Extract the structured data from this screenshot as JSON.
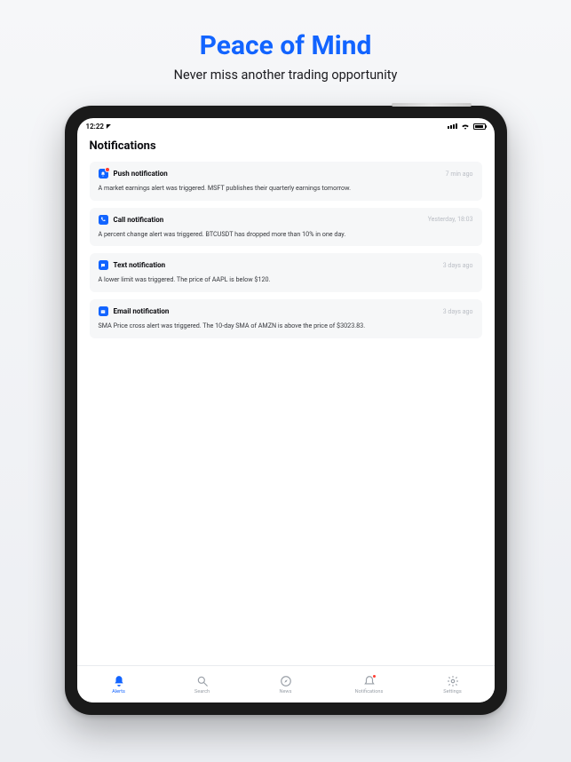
{
  "hero": {
    "title": "Peace of Mind",
    "subtitle": "Never miss another trading opportunity"
  },
  "status": {
    "time": "12:22",
    "location_arrow": "➤"
  },
  "page": {
    "title": "Notifications"
  },
  "notifications": [
    {
      "icon": "push",
      "title": "Push notification",
      "time": "7 min ago",
      "body": "A market earnings alert was triggered. MSFT publishes their quarterly earnings tomorrow."
    },
    {
      "icon": "call",
      "title": "Call notification",
      "time": "Yesterday, 18:03",
      "body": "A percent change alert was triggered. BTCUSDT has dropped more than 10% in one day."
    },
    {
      "icon": "text",
      "title": "Text notification",
      "time": "3 days ago",
      "body": "A lower limit was triggered. The price of AAPL is below $120."
    },
    {
      "icon": "email",
      "title": "Email notification",
      "time": "3 days ago",
      "body": "SMA Price cross alert was triggered. The 10-day SMA of AMZN is above the price of $3023.83."
    }
  ],
  "tabs": {
    "alerts": "Alerts",
    "search": "Search",
    "news": "News",
    "notifications": "Notifications",
    "settings": "Settings"
  }
}
